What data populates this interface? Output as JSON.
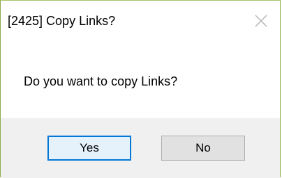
{
  "dialog": {
    "title": "[2425] Copy Links?",
    "message": "Do you want to copy Links?",
    "buttons": {
      "yes_label": "Yes",
      "no_label": "No"
    },
    "close_icon": "close-icon",
    "colors": {
      "default_button_border": "#0078d7",
      "footer_background": "#f0f0f0",
      "window_border": "#8faa4a"
    }
  }
}
